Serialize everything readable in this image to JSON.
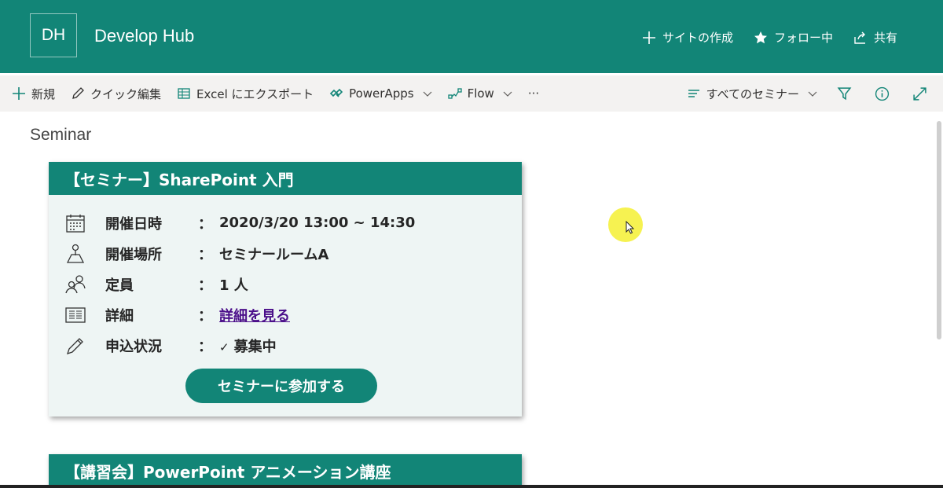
{
  "site": {
    "logo_text": "DH",
    "title": "Develop Hub",
    "actions": [
      {
        "label": "サイトの作成",
        "icon": "plus-icon"
      },
      {
        "label": "フォロー中",
        "icon": "star-icon"
      },
      {
        "label": "共有",
        "icon": "share-icon"
      }
    ]
  },
  "command_bar": {
    "new_label": "新規",
    "quick_edit_label": "クイック編集",
    "excel_label": "Excel にエクスポート",
    "powerapps_label": "PowerApps",
    "flow_label": "Flow",
    "more_label": "···",
    "view_label": "すべてのセミナー"
  },
  "page": {
    "heading": "Seminar"
  },
  "cards": [
    {
      "title": "【セミナー】SharePoint 入門",
      "rows": [
        {
          "label": "開催日時",
          "colon": "：",
          "value": "2020/3/20 13:00 ~ 14:30"
        },
        {
          "label": "開催場所",
          "colon": "：",
          "value": "セミナールームA"
        },
        {
          "label": "定員",
          "colon": "：",
          "value": "1 人"
        },
        {
          "label": "詳細",
          "colon": "：",
          "value": "詳細を見る"
        },
        {
          "label": "申込状況",
          "colon": "：",
          "check": "✓",
          "value": "募集中"
        }
      ],
      "button_label": "セミナーに参加する"
    },
    {
      "title": "【講習会】PowerPoint アニメーション講座"
    }
  ],
  "colors": {
    "brand": "#128577",
    "card_bg": "#eef5f4",
    "link": "#4b0f8a",
    "command_bar_bg": "#f3f2f1"
  }
}
